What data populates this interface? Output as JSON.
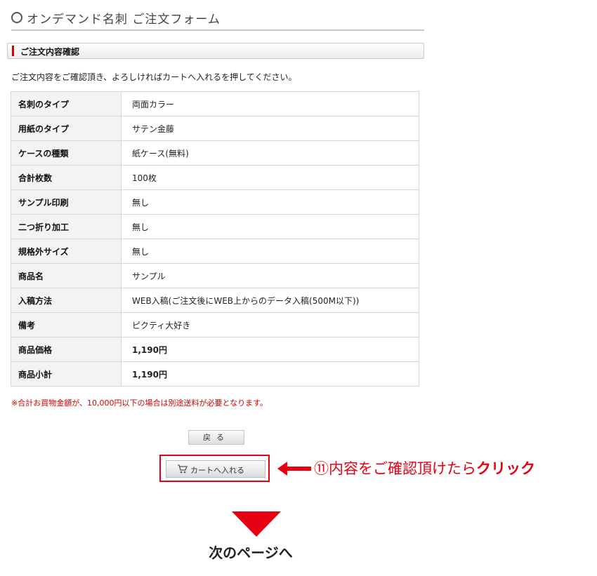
{
  "page": {
    "title": "オンデマンド名刺 ご注文フォーム"
  },
  "section": {
    "title": "ご注文内容確認"
  },
  "instruction": "ご注文内容をご確認頂き、よろしければカートへ入れるを押してください。",
  "order_rows": [
    {
      "label": "名刺のタイプ",
      "value": "両面カラー"
    },
    {
      "label": "用紙のタイプ",
      "value": "サテン金藤"
    },
    {
      "label": "ケースの種類",
      "value": "紙ケース(無料)"
    },
    {
      "label": "合計枚数",
      "value": "100枚"
    },
    {
      "label": "サンプル印刷",
      "value": "無し"
    },
    {
      "label": "二つ折り加工",
      "value": "無し"
    },
    {
      "label": "規格外サイズ",
      "value": "無し"
    },
    {
      "label": "商品名",
      "value": "サンプル"
    },
    {
      "label": "入稿方法",
      "value": "WEB入稿(ご注文後にWEB上からのデータ入稿(500M以下))"
    },
    {
      "label": "備考",
      "value": "ピクティ大好き"
    },
    {
      "label": "商品価格",
      "value": "1,190円"
    },
    {
      "label": "商品小計",
      "value": "1,190円"
    }
  ],
  "notice": "※合計お買物金額が、10,000円以下の場合は別途送料が必要となります。",
  "buttons": {
    "back_label": "戻る",
    "cart_label": "カートへ入れる"
  },
  "annotation": {
    "number": "⑪",
    "text": "内容をご確認頂けたら",
    "emphasis": "クリック"
  },
  "next": {
    "label": "次のページへ"
  },
  "colors": {
    "accent_red": "#e60012",
    "notice_red": "#d00000"
  },
  "icons": {
    "title": "circle-icon",
    "cart": "cart-icon",
    "arrow": "arrow-left-icon",
    "down": "down-triangle-icon"
  }
}
